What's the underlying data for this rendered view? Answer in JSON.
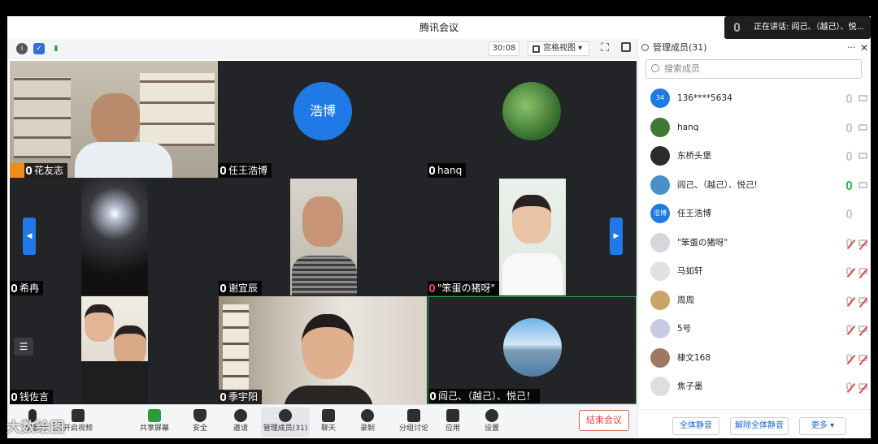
{
  "window": {
    "title": "腾讯会议"
  },
  "toolbar": {
    "timer": "30:08",
    "view_label": "宫格视图"
  },
  "speaking_banner": {
    "text": "正在讲话: 阎己、（越己）、悦..."
  },
  "tiles": [
    {
      "name": "花友志",
      "mic": "on"
    },
    {
      "name": "任王浩博",
      "mic": "on",
      "avatar_text": "浩博"
    },
    {
      "name": "hanq",
      "mic": "on"
    },
    {
      "name": "希冉",
      "mic": "on"
    },
    {
      "name": "谢宜辰",
      "mic": "on"
    },
    {
      "name": "\"笨蛋の猪呀\"",
      "mic": "muted"
    },
    {
      "name": "钱佐言",
      "mic": "on"
    },
    {
      "name": "季宇阳",
      "mic": "on"
    },
    {
      "name": "阎己、（越己）、悦己！",
      "mic": "on"
    }
  ],
  "sidebar": {
    "header": "管理成员(31)",
    "search_placeholder": "搜索成员",
    "members": [
      {
        "avatar_text": "34",
        "name": "136****5634",
        "avatar_color": "#1f7ae8"
      },
      {
        "avatar_text": "",
        "name": "hanq",
        "avatar_color": "#3e7a32"
      },
      {
        "avatar_text": "",
        "name": "东桥头堡",
        "avatar_color": "#2b2b2b"
      },
      {
        "avatar_text": "",
        "name": "阎己、（越己）、悦己!",
        "avatar_color": "#4a90c8"
      },
      {
        "avatar_text": "浩博",
        "name": "任王浩博",
        "avatar_color": "#1f7ae8"
      },
      {
        "avatar_text": "",
        "name": "\"笨蛋の猪呀\"",
        "avatar_color": "#d6d6dd"
      },
      {
        "avatar_text": "",
        "name": "马如轩",
        "avatar_color": "#e2e2e2"
      },
      {
        "avatar_text": "",
        "name": "周周",
        "avatar_color": "#c9a56b"
      },
      {
        "avatar_text": "",
        "name": "5号",
        "avatar_color": "#c8cbe3"
      },
      {
        "avatar_text": "",
        "name": "棣文168",
        "avatar_color": "#9c7a62"
      },
      {
        "avatar_text": "",
        "name": "焦子墨",
        "avatar_color": "#dedede"
      }
    ],
    "footer": {
      "mute_all": "全体静音",
      "unmute_all": "解除全体静音",
      "more": "更多 ▾"
    }
  },
  "bottombar": {
    "items": [
      "静音",
      "开启视频",
      "共享屏幕",
      "安全",
      "邀请",
      "管理成员(31)",
      "聊天",
      "录制",
      "分组讨论",
      "应用",
      "设置"
    ],
    "end_meeting": "结束会议"
  },
  "watermark": "大数绘图"
}
